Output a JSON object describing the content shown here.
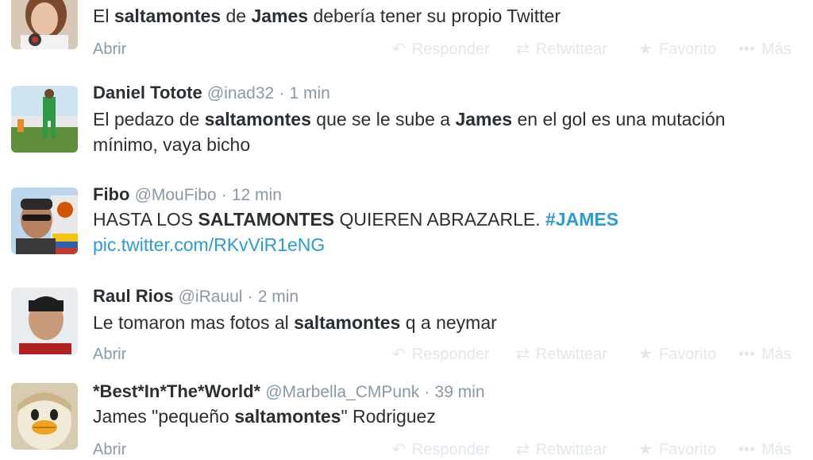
{
  "actions": {
    "open": "Abrir",
    "reply": "Responder",
    "retweet": "Retwittear",
    "favorite": "Favorito",
    "more": "Más"
  },
  "tweets": [
    {
      "parts": [
        {
          "t": "El ",
          "b": false
        },
        {
          "t": "saltamontes",
          "b": true
        },
        {
          "t": " de ",
          "b": false
        },
        {
          "t": "James",
          "b": true
        },
        {
          "t": " debería tener su propio Twitter",
          "b": false
        }
      ]
    },
    {
      "name": "Daniel Totote",
      "handle": "@inad32",
      "sep": "·",
      "time": "1 min",
      "parts": [
        {
          "t": "El pedazo de ",
          "b": false
        },
        {
          "t": "saltamontes",
          "b": true
        },
        {
          "t": " que se le sube a ",
          "b": false
        },
        {
          "t": "James",
          "b": true
        },
        {
          "t": " en el gol es una mutación",
          "b": false
        }
      ],
      "line2": "mínimo, vaya bicho"
    },
    {
      "name": "Fibo",
      "handle": "@MouFibo",
      "sep": "·",
      "time": "12 min",
      "parts": [
        {
          "t": "HASTA LOS ",
          "b": false
        },
        {
          "t": "SALTAMONTES",
          "b": true
        },
        {
          "t": " QUIEREN ABRAZARLE. ",
          "b": false
        }
      ],
      "hashtag": "#JAMES",
      "link": "pic.twitter.com/RKvViR1eNG"
    },
    {
      "name": "Raul Rios",
      "handle": "@iRauul",
      "sep": "·",
      "time": "2 min",
      "parts": [
        {
          "t": "Le tomaron mas fotos al ",
          "b": false
        },
        {
          "t": "saltamontes",
          "b": true
        },
        {
          "t": " q a neymar",
          "b": false
        }
      ]
    },
    {
      "name": "*Best*In*The*World*",
      "handle": "@Marbella_CMPunk",
      "sep": "·",
      "time": "39 min",
      "parts": [
        {
          "t": "James \"pequeño ",
          "b": false
        },
        {
          "t": "saltamontes",
          "b": true
        },
        {
          "t": "\" Rodriguez",
          "b": false
        }
      ]
    }
  ]
}
